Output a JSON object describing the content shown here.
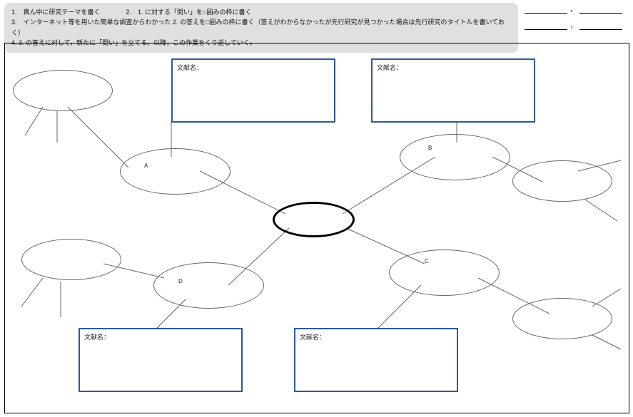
{
  "instructions": {
    "line1": "1.　真ん中に研究テーマを書く　　　　2.　1. に対する「問い」を○囲みの枠に書く",
    "line2": "3.　インターネット等を用いた簡単な調査からわかった 2. の答えを□囲みの枠に書く（答えがわからなかったが先行研究が見つかった場合は先行研究のタイトルを書いておく）",
    "line3": "4. 3. の答えに対して，新たに「問い」を立てる。以降，この作業をくり返していく。"
  },
  "refbox_label": "文献名：",
  "node_labels": {
    "A": "A",
    "B": "B",
    "C": "C",
    "D": "D"
  },
  "signature": {
    "sep": "，"
  }
}
